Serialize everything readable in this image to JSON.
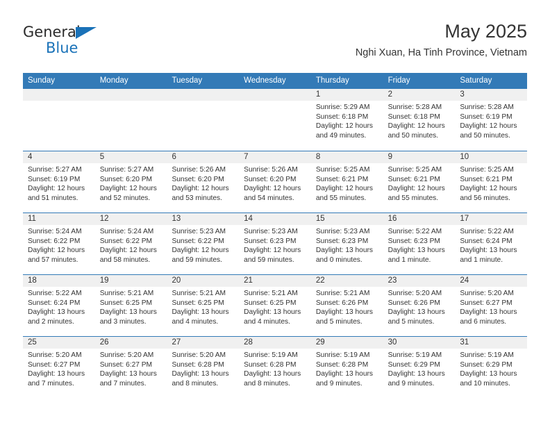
{
  "brand": {
    "line1": "General",
    "line2": "Blue",
    "accent_color": "#1a72b8",
    "triangle_icon": "triangle-icon"
  },
  "header": {
    "title": "May 2025",
    "subtitle": "Nghi Xuan, Ha Tinh Province, Vietnam"
  },
  "theme": {
    "header_bg": "#337ab7",
    "day_band_bg": "#f0f0f0",
    "text": "#333333"
  },
  "calendar": {
    "weekday_headers": [
      "Sunday",
      "Monday",
      "Tuesday",
      "Wednesday",
      "Thursday",
      "Friday",
      "Saturday"
    ],
    "weeks": [
      [
        {
          "day": "",
          "empty": true
        },
        {
          "day": "",
          "empty": true
        },
        {
          "day": "",
          "empty": true
        },
        {
          "day": "",
          "empty": true
        },
        {
          "day": "1",
          "sunrise": "Sunrise: 5:29 AM",
          "sunset": "Sunset: 6:18 PM",
          "daylight_l1": "Daylight: 12 hours",
          "daylight_l2": "and 49 minutes."
        },
        {
          "day": "2",
          "sunrise": "Sunrise: 5:28 AM",
          "sunset": "Sunset: 6:18 PM",
          "daylight_l1": "Daylight: 12 hours",
          "daylight_l2": "and 50 minutes."
        },
        {
          "day": "3",
          "sunrise": "Sunrise: 5:28 AM",
          "sunset": "Sunset: 6:19 PM",
          "daylight_l1": "Daylight: 12 hours",
          "daylight_l2": "and 50 minutes."
        }
      ],
      [
        {
          "day": "4",
          "sunrise": "Sunrise: 5:27 AM",
          "sunset": "Sunset: 6:19 PM",
          "daylight_l1": "Daylight: 12 hours",
          "daylight_l2": "and 51 minutes."
        },
        {
          "day": "5",
          "sunrise": "Sunrise: 5:27 AM",
          "sunset": "Sunset: 6:20 PM",
          "daylight_l1": "Daylight: 12 hours",
          "daylight_l2": "and 52 minutes."
        },
        {
          "day": "6",
          "sunrise": "Sunrise: 5:26 AM",
          "sunset": "Sunset: 6:20 PM",
          "daylight_l1": "Daylight: 12 hours",
          "daylight_l2": "and 53 minutes."
        },
        {
          "day": "7",
          "sunrise": "Sunrise: 5:26 AM",
          "sunset": "Sunset: 6:20 PM",
          "daylight_l1": "Daylight: 12 hours",
          "daylight_l2": "and 54 minutes."
        },
        {
          "day": "8",
          "sunrise": "Sunrise: 5:25 AM",
          "sunset": "Sunset: 6:21 PM",
          "daylight_l1": "Daylight: 12 hours",
          "daylight_l2": "and 55 minutes."
        },
        {
          "day": "9",
          "sunrise": "Sunrise: 5:25 AM",
          "sunset": "Sunset: 6:21 PM",
          "daylight_l1": "Daylight: 12 hours",
          "daylight_l2": "and 55 minutes."
        },
        {
          "day": "10",
          "sunrise": "Sunrise: 5:25 AM",
          "sunset": "Sunset: 6:21 PM",
          "daylight_l1": "Daylight: 12 hours",
          "daylight_l2": "and 56 minutes."
        }
      ],
      [
        {
          "day": "11",
          "sunrise": "Sunrise: 5:24 AM",
          "sunset": "Sunset: 6:22 PM",
          "daylight_l1": "Daylight: 12 hours",
          "daylight_l2": "and 57 minutes."
        },
        {
          "day": "12",
          "sunrise": "Sunrise: 5:24 AM",
          "sunset": "Sunset: 6:22 PM",
          "daylight_l1": "Daylight: 12 hours",
          "daylight_l2": "and 58 minutes."
        },
        {
          "day": "13",
          "sunrise": "Sunrise: 5:23 AM",
          "sunset": "Sunset: 6:22 PM",
          "daylight_l1": "Daylight: 12 hours",
          "daylight_l2": "and 59 minutes."
        },
        {
          "day": "14",
          "sunrise": "Sunrise: 5:23 AM",
          "sunset": "Sunset: 6:23 PM",
          "daylight_l1": "Daylight: 12 hours",
          "daylight_l2": "and 59 minutes."
        },
        {
          "day": "15",
          "sunrise": "Sunrise: 5:23 AM",
          "sunset": "Sunset: 6:23 PM",
          "daylight_l1": "Daylight: 13 hours",
          "daylight_l2": "and 0 minutes."
        },
        {
          "day": "16",
          "sunrise": "Sunrise: 5:22 AM",
          "sunset": "Sunset: 6:23 PM",
          "daylight_l1": "Daylight: 13 hours",
          "daylight_l2": "and 1 minute."
        },
        {
          "day": "17",
          "sunrise": "Sunrise: 5:22 AM",
          "sunset": "Sunset: 6:24 PM",
          "daylight_l1": "Daylight: 13 hours",
          "daylight_l2": "and 1 minute."
        }
      ],
      [
        {
          "day": "18",
          "sunrise": "Sunrise: 5:22 AM",
          "sunset": "Sunset: 6:24 PM",
          "daylight_l1": "Daylight: 13 hours",
          "daylight_l2": "and 2 minutes."
        },
        {
          "day": "19",
          "sunrise": "Sunrise: 5:21 AM",
          "sunset": "Sunset: 6:25 PM",
          "daylight_l1": "Daylight: 13 hours",
          "daylight_l2": "and 3 minutes."
        },
        {
          "day": "20",
          "sunrise": "Sunrise: 5:21 AM",
          "sunset": "Sunset: 6:25 PM",
          "daylight_l1": "Daylight: 13 hours",
          "daylight_l2": "and 4 minutes."
        },
        {
          "day": "21",
          "sunrise": "Sunrise: 5:21 AM",
          "sunset": "Sunset: 6:25 PM",
          "daylight_l1": "Daylight: 13 hours",
          "daylight_l2": "and 4 minutes."
        },
        {
          "day": "22",
          "sunrise": "Sunrise: 5:21 AM",
          "sunset": "Sunset: 6:26 PM",
          "daylight_l1": "Daylight: 13 hours",
          "daylight_l2": "and 5 minutes."
        },
        {
          "day": "23",
          "sunrise": "Sunrise: 5:20 AM",
          "sunset": "Sunset: 6:26 PM",
          "daylight_l1": "Daylight: 13 hours",
          "daylight_l2": "and 5 minutes."
        },
        {
          "day": "24",
          "sunrise": "Sunrise: 5:20 AM",
          "sunset": "Sunset: 6:27 PM",
          "daylight_l1": "Daylight: 13 hours",
          "daylight_l2": "and 6 minutes."
        }
      ],
      [
        {
          "day": "25",
          "sunrise": "Sunrise: 5:20 AM",
          "sunset": "Sunset: 6:27 PM",
          "daylight_l1": "Daylight: 13 hours",
          "daylight_l2": "and 7 minutes."
        },
        {
          "day": "26",
          "sunrise": "Sunrise: 5:20 AM",
          "sunset": "Sunset: 6:27 PM",
          "daylight_l1": "Daylight: 13 hours",
          "daylight_l2": "and 7 minutes."
        },
        {
          "day": "27",
          "sunrise": "Sunrise: 5:20 AM",
          "sunset": "Sunset: 6:28 PM",
          "daylight_l1": "Daylight: 13 hours",
          "daylight_l2": "and 8 minutes."
        },
        {
          "day": "28",
          "sunrise": "Sunrise: 5:19 AM",
          "sunset": "Sunset: 6:28 PM",
          "daylight_l1": "Daylight: 13 hours",
          "daylight_l2": "and 8 minutes."
        },
        {
          "day": "29",
          "sunrise": "Sunrise: 5:19 AM",
          "sunset": "Sunset: 6:28 PM",
          "daylight_l1": "Daylight: 13 hours",
          "daylight_l2": "and 9 minutes."
        },
        {
          "day": "30",
          "sunrise": "Sunrise: 5:19 AM",
          "sunset": "Sunset: 6:29 PM",
          "daylight_l1": "Daylight: 13 hours",
          "daylight_l2": "and 9 minutes."
        },
        {
          "day": "31",
          "sunrise": "Sunrise: 5:19 AM",
          "sunset": "Sunset: 6:29 PM",
          "daylight_l1": "Daylight: 13 hours",
          "daylight_l2": "and 10 minutes."
        }
      ]
    ]
  }
}
